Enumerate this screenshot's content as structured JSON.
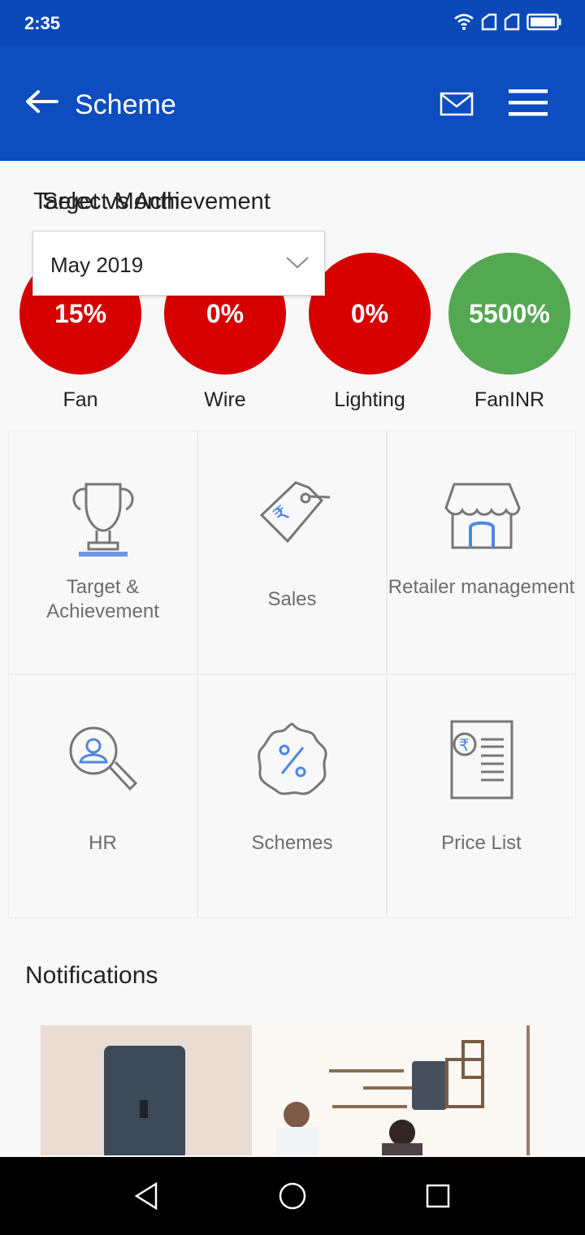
{
  "status": {
    "time": "2:35"
  },
  "appbar": {
    "title": "Scheme"
  },
  "section": {
    "title": "Target vs Achievement",
    "overlap_label": "Select Month"
  },
  "month_select": {
    "value": "May 2019"
  },
  "metrics": [
    {
      "value": "15%",
      "label": "Fan",
      "color": "#d60000"
    },
    {
      "value": "0%",
      "label": "Wire",
      "color": "#d60000"
    },
    {
      "value": "0%",
      "label": "Lighting",
      "color": "#d60000"
    },
    {
      "value": "5500%",
      "label": "FanINR",
      "color": "#54a852"
    }
  ],
  "tiles": [
    {
      "label": "Target & Achievement",
      "icon": "trophy-icon"
    },
    {
      "label": "Sales",
      "icon": "price-tag-icon"
    },
    {
      "label": "Retailer management",
      "icon": "store-icon"
    },
    {
      "label": "HR",
      "icon": "user-search-icon"
    },
    {
      "label": "Schemes",
      "icon": "percent-badge-icon"
    },
    {
      "label": "Price List",
      "icon": "price-list-icon"
    }
  ],
  "notifications": {
    "title": "Notifications"
  },
  "colors": {
    "appbar": "#0d4dbf",
    "red": "#d60000",
    "green": "#54a852"
  }
}
